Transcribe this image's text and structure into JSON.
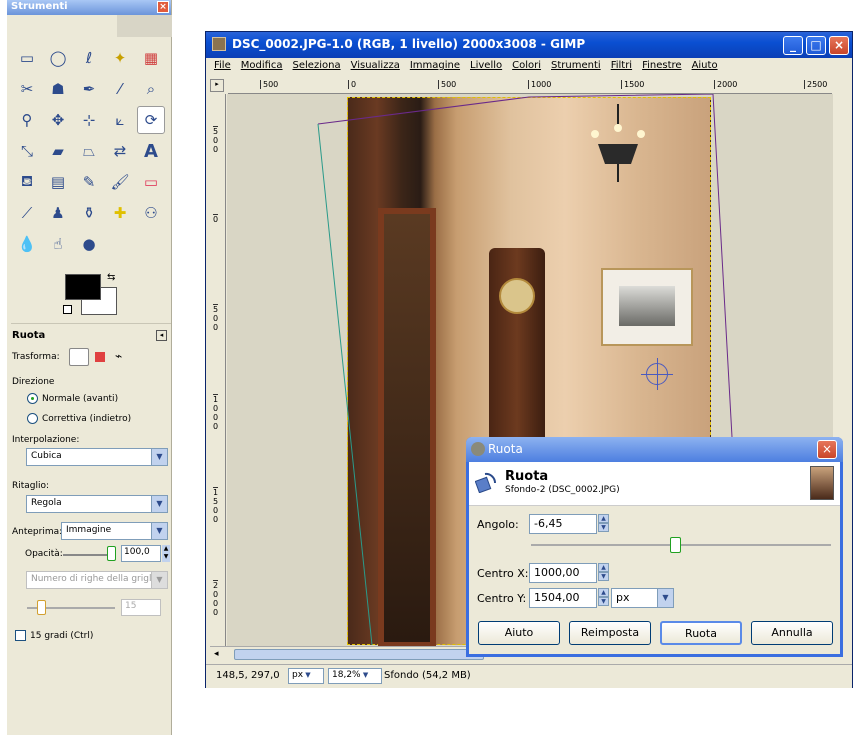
{
  "toolbox": {
    "title": "Strumenti",
    "close": "×",
    "tools": [
      "rect-select-icon",
      "ellipse-select-icon",
      "lasso-icon",
      "fuzzy-select-icon",
      "color-select-icon",
      "scissors-icon",
      "foreground-select-icon",
      "paths-icon",
      "color-picker-icon",
      "zoom-icon",
      "measure-icon",
      "move-icon",
      "align-icon",
      "crop-icon",
      "rotate-icon",
      "scale-icon",
      "shear-icon",
      "perspective-icon",
      "flip-icon",
      "text-icon",
      "bucket-fill-icon",
      "blend-icon",
      "pencil-icon",
      "paintbrush-icon",
      "eraser-icon",
      "airbrush-icon",
      "ink-icon",
      "clone-icon",
      "heal-icon",
      "perspective-clone-icon",
      "blur-icon",
      "smudge-icon",
      "dodge-burn-icon"
    ],
    "colors": {
      "fg": "#000000",
      "bg": "#ffffff"
    },
    "options": {
      "title": "Ruota",
      "transform_label": "Trasforma:",
      "direction_label": "Direzione",
      "dir_normal": "Normale (avanti)",
      "dir_corrective": "Correttiva (indietro)",
      "interp_label": "Interpolazione:",
      "interp_value": "Cubica",
      "clip_label": "Ritaglio:",
      "clip_value": "Regola",
      "preview_label": "Anteprima:",
      "preview_value": "Immagine",
      "opacity_label": "Opacità:",
      "opacity_value": "100,0",
      "grid_value": "Numero di righe della griglia",
      "grid_count": "15",
      "deg15_label": "15 gradi  (Ctrl)"
    }
  },
  "imagewindow": {
    "title": "DSC_0002.JPG-1.0 (RGB, 1 livello) 2000x3008 - GIMP",
    "menu": [
      "File",
      "Modifica",
      "Seleziona",
      "Visualizza",
      "Immagine",
      "Livello",
      "Colori",
      "Strumenti",
      "Filtri",
      "Finestre",
      "Aiuto"
    ],
    "ruler_top": [
      "500",
      "0",
      "500",
      "1000",
      "1500",
      "2000",
      "2500"
    ],
    "ruler_left": [
      "5\n0\n0",
      "0",
      "5\n0\n0",
      "1\n0\n0\n0",
      "1\n5\n0\n0",
      "2\n0\n0\n0",
      "2\n5\n0\n0"
    ],
    "status": {
      "coords": "148,5, 297,0",
      "unit": "px",
      "zoom": "18,2%",
      "layer_info": "Sfondo (54,2 MB)"
    }
  },
  "dialog": {
    "title": "Ruota",
    "close": "×",
    "head_title": "Ruota",
    "head_sub": "Sfondo-2 (DSC_0002.JPG)",
    "angle_label": "Angolo:",
    "angle_value": "-6,45",
    "angle_slider_fraction": 0.48,
    "cx_label": "Centro X:",
    "cx_value": "1000,00",
    "cy_label": "Centro Y:",
    "cy_value": "1504,00",
    "unit": "px",
    "buttons": {
      "help": "Aiuto",
      "reset": "Reimposta",
      "rotate": "Ruota",
      "cancel": "Annulla"
    }
  }
}
